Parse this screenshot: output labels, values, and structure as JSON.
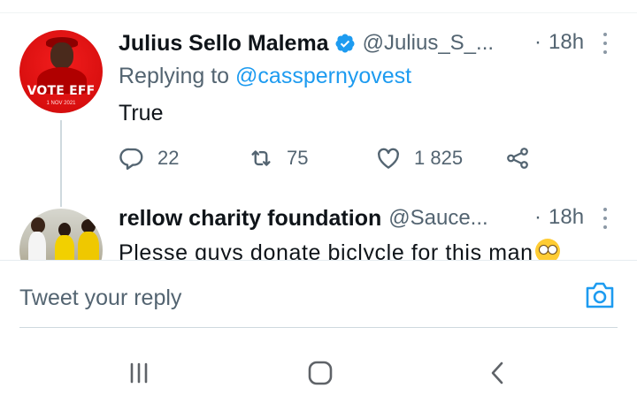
{
  "tweets": [
    {
      "name": "Julius Sello Malema",
      "verified": true,
      "handle": "@Julius_S_...",
      "separator": "·",
      "time": "18h",
      "replying_prefix": "Replying to",
      "replying_mention": "@casspernyovest",
      "text": "True",
      "avatar_text": "VOTE EFF",
      "avatar_date": "1 NOV 2021",
      "stats": {
        "replies": "22",
        "retweets": "75",
        "likes": "1 825"
      }
    },
    {
      "name": "rellow charity foundation",
      "verified": false,
      "handle": "@Sauce...",
      "separator": "·",
      "time": "18h",
      "text": "Plesse guys donate biclycle for this man"
    }
  ],
  "reply": {
    "placeholder": "Tweet your reply"
  },
  "icons": {
    "verified": "verified-badge-icon",
    "reply": "reply-icon",
    "retweet": "retweet-icon",
    "like": "heart-icon",
    "share": "share-icon",
    "more": "more-vertical-icon",
    "camera": "camera-icon",
    "nav_recents": "recents-icon",
    "nav_home": "home-icon",
    "nav_back": "back-icon"
  },
  "colors": {
    "accent": "#1d9bf0",
    "secondary_text": "#536471",
    "primary_text": "#0f1419"
  }
}
